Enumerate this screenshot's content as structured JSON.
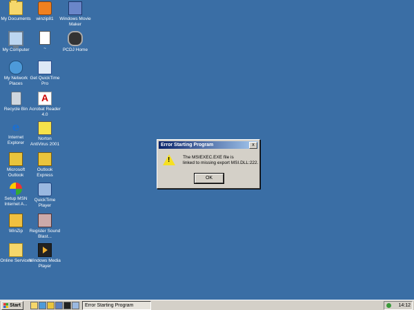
{
  "desktop_icons": [
    {
      "label": "My Documents",
      "icon": "my-documents-icon"
    },
    {
      "label": "My Computer",
      "icon": "my-computer-icon"
    },
    {
      "label": "My Network Places",
      "icon": "network-places-icon"
    },
    {
      "label": "Recycle Bin",
      "icon": "recycle-bin-icon"
    },
    {
      "label": "Internet Explorer",
      "icon": "internet-explorer-icon"
    },
    {
      "label": "Microsoft Outlook",
      "icon": "outlook-icon"
    },
    {
      "label": "Setup MSN Internet A...",
      "icon": "msn-icon"
    },
    {
      "label": "WinZip",
      "icon": "winzip-icon"
    },
    {
      "label": "Online Services",
      "icon": "folder-icon"
    },
    {
      "label": "winzip81",
      "icon": "winzip81-icon"
    },
    {
      "label": "~",
      "icon": "document-icon"
    },
    {
      "label": "Get QuickTime Pro",
      "icon": "quicktime-icon"
    },
    {
      "label": "Acrobat Reader 4.0",
      "icon": "acrobat-icon"
    },
    {
      "label": "Norton AntiVirus 2001",
      "icon": "norton-icon"
    },
    {
      "label": "Outlook Express",
      "icon": "outlook-express-icon"
    },
    {
      "label": "QuickTime Player",
      "icon": "quicktime-player-icon"
    },
    {
      "label": "Register Sound Blast...",
      "icon": "sound-blaster-icon"
    },
    {
      "label": "Windows Media Player",
      "icon": "media-player-icon"
    },
    {
      "label": "Windows Movie Maker",
      "icon": "movie-maker-icon"
    },
    {
      "label": "PCDJ Home",
      "icon": "pcdj-icon"
    }
  ],
  "dialog": {
    "title": "Error Starting Program",
    "close_glyph": "x",
    "message_line1": "The MSIEXEC.EXE file is",
    "message_line2": "linked to missing export MSI.DLL:222.",
    "ok_label": "OK",
    "icon": "warning-icon"
  },
  "taskbar": {
    "start_label": "Start",
    "task_label": "Error Starting Program",
    "clock": "14:12"
  },
  "colors": {
    "desktop": "#3a6ea5",
    "title_active": "#0a246a"
  }
}
